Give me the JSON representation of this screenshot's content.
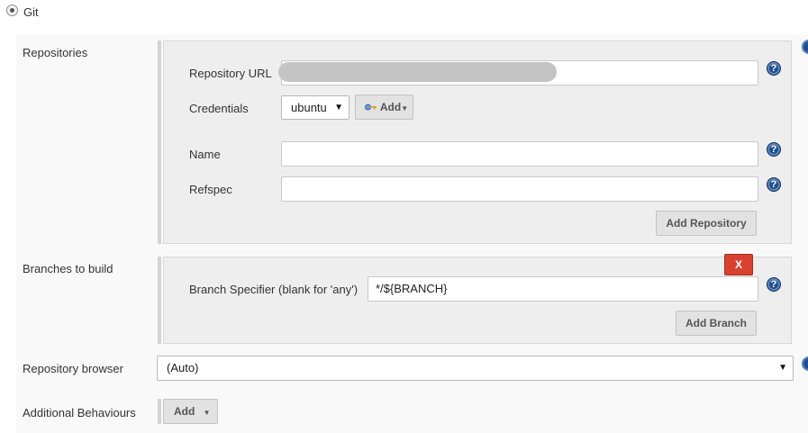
{
  "scm": {
    "option_label": "Git"
  },
  "repositories": {
    "section_label": "Repositories",
    "url_label": "Repository URL",
    "url_value": "",
    "credentials_label": "Credentials",
    "credentials_value": "ubuntu",
    "add_credential_label": "Add",
    "name_label": "Name",
    "name_value": "",
    "refspec_label": "Refspec",
    "refspec_value": "",
    "add_repository_label": "Add Repository"
  },
  "branches": {
    "section_label": "Branches to build",
    "specifier_label": "Branch Specifier (blank for 'any')",
    "specifier_value": "*/${BRANCH}",
    "delete_label": "X",
    "add_branch_label": "Add Branch"
  },
  "repo_browser": {
    "label": "Repository browser",
    "value": "(Auto)"
  },
  "additional_behaviours": {
    "label": "Additional Behaviours",
    "add_label": "Add"
  },
  "icons": {
    "help": "help-icon",
    "key": "key-icon",
    "dropdown": "chevron-down-icon",
    "radio": "radio-icon"
  },
  "colors": {
    "help_blue": "#204f8c",
    "delete_red": "#d9412e",
    "chunk_bg": "#eeeeee"
  }
}
